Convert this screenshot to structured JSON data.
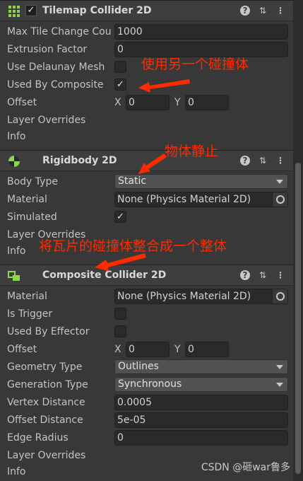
{
  "tilemap_collider": {
    "title": "Tilemap Collider 2D",
    "icon": "grid-icon",
    "rows": {
      "max_tile_change": {
        "label": "Max Tile Change Count",
        "value": "1000"
      },
      "extrusion_factor": {
        "label": "Extrusion Factor",
        "value": "0"
      },
      "use_delaunay": {
        "label": "Use Delaunay Mesh",
        "checked": false
      },
      "used_by_composite": {
        "label": "Used By Composite",
        "checked": true,
        "check": "✓"
      },
      "offset": {
        "label": "Offset",
        "x_label": "X",
        "x": "0",
        "y_label": "Y",
        "y": "0"
      },
      "layer_overrides": {
        "label": "Layer Overrides"
      },
      "info": {
        "label": "Info"
      }
    }
  },
  "rigidbody": {
    "title": "Rigidbody 2D",
    "icon": "rigidbody-icon",
    "rows": {
      "body_type": {
        "label": "Body Type",
        "value": "Static"
      },
      "material": {
        "label": "Material",
        "value": "None (Physics Material 2D)"
      },
      "simulated": {
        "label": "Simulated",
        "checked": true,
        "check": "✓"
      },
      "layer_overrides": {
        "label": "Layer Overrides"
      },
      "info": {
        "label": "Info"
      }
    }
  },
  "composite_collider": {
    "title": "Composite Collider 2D",
    "icon": "composite-collider-icon",
    "rows": {
      "material": {
        "label": "Material",
        "value": "None (Physics Material 2D)"
      },
      "is_trigger": {
        "label": "Is Trigger",
        "checked": false
      },
      "used_by_effector": {
        "label": "Used By Effector",
        "checked": false
      },
      "offset": {
        "label": "Offset",
        "x_label": "X",
        "x": "0",
        "y_label": "Y",
        "y": "0"
      },
      "geometry_type": {
        "label": "Geometry Type",
        "value": "Outlines"
      },
      "generation_type": {
        "label": "Generation Type",
        "value": "Synchronous"
      },
      "vertex_distance": {
        "label": "Vertex Distance",
        "value": "0.0005"
      },
      "offset_distance": {
        "label": "Offset Distance",
        "value": "5e-05"
      },
      "edge_radius": {
        "label": "Edge Radius",
        "value": "0"
      },
      "layer_overrides": {
        "label": "Layer Overrides"
      },
      "info": {
        "label": "Info"
      }
    }
  },
  "header_buttons": {
    "help": "?",
    "presets": "⇅",
    "menu": "⋮"
  },
  "annotations": {
    "composite_note": "使用另一个碰撞体",
    "static_note": "物体静止",
    "merge_note": "将瓦片的碰撞体整合成一个整体"
  },
  "watermark": "CSDN @砸war鲁多",
  "colors": {
    "annotation": "#ff2a00",
    "background": "#383838",
    "header": "#3e3e3e"
  }
}
